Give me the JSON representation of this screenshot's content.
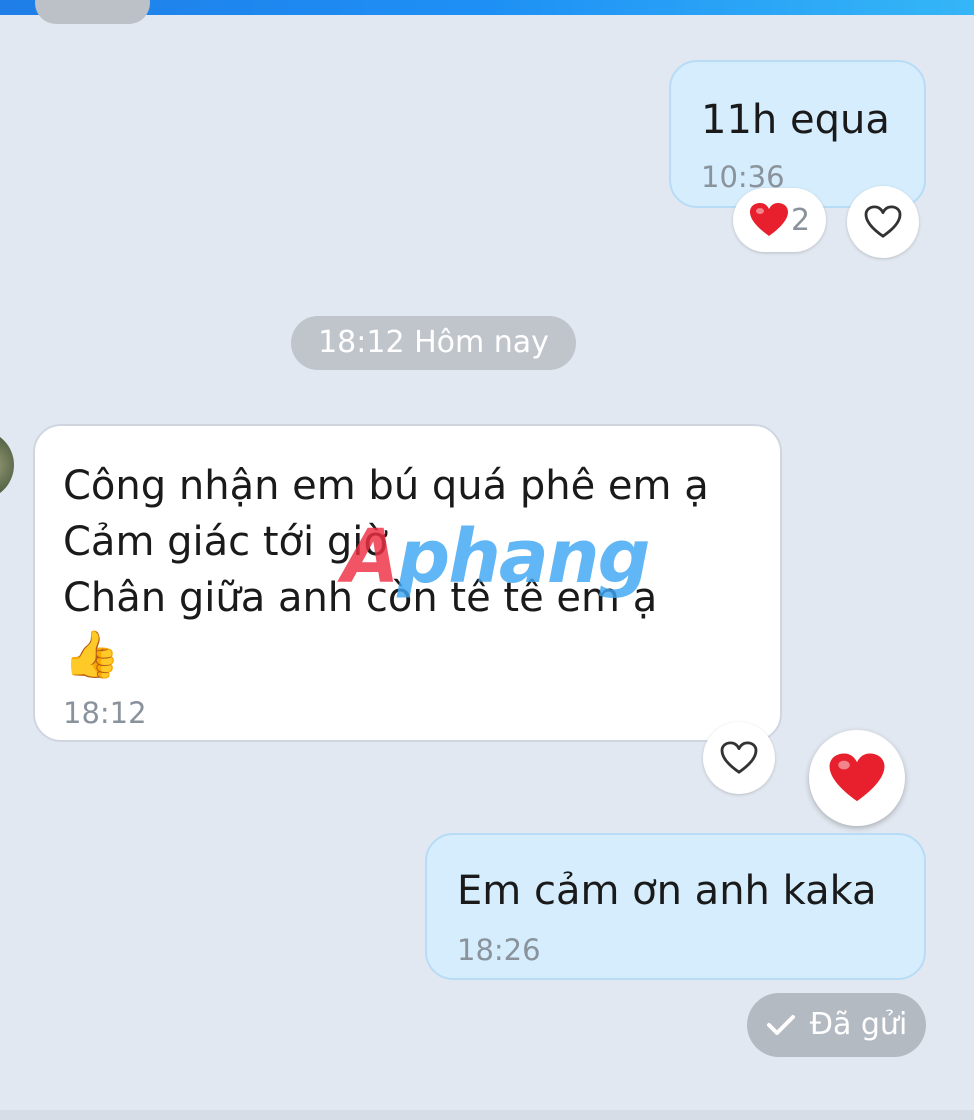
{
  "messages": [
    {
      "direction": "outgoing",
      "lines": [
        "11h equa"
      ],
      "time": "10:36",
      "reactions": {
        "heart_count": "2"
      }
    },
    {
      "direction": "incoming",
      "lines": [
        "Công nhận em bú quá phê em ạ",
        "Cảm giác tới giờ",
        "Chân giữa anh còn tê tê em ạ"
      ],
      "emoji": "👍",
      "time": "18:12"
    },
    {
      "direction": "outgoing",
      "lines": [
        "Em cảm ơn anh kaka"
      ],
      "time": "18:26"
    }
  ],
  "date_divider": "18:12 Hôm nay",
  "sent_status": "Đã gửi",
  "watermark": {
    "first": "A",
    "rest": "phang"
  },
  "icons": {
    "reacted_heart": "red-heart-icon",
    "react_button": "heart-outline-icon",
    "status_check": "check-icon",
    "emoji": "thumbs-up-icon"
  },
  "colors": {
    "outgoing_bubble": "#d5edfc",
    "incoming_bubble": "#ffffff",
    "heart_red": "#e8202e",
    "top_bar": "#1e90f5",
    "background": "#e2e8f1"
  }
}
